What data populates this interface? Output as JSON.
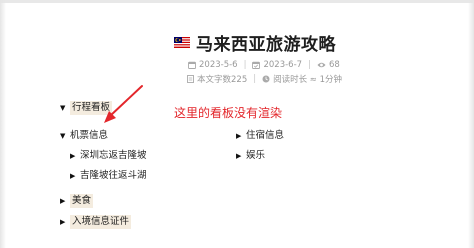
{
  "doc": {
    "title": "马来西亚旅游攻略",
    "flag_icon": "malaysia-flag-icon",
    "created": "2023-5-6",
    "updated": "2023-6-7",
    "views": "68",
    "word_count": "本文字数225",
    "read_time": "阅读时长 ≈ 1分钟"
  },
  "mindmap": {
    "root": "行程看板",
    "branches": [
      {
        "label": "机票信息",
        "children": [
          "深圳忘返吉隆坡",
          "吉隆坡往返斗湖"
        ]
      },
      {
        "label": "住宿信息"
      },
      {
        "label": "娱乐"
      },
      {
        "label": "美食"
      },
      {
        "label": "入境信息证件"
      }
    ]
  },
  "annotation": {
    "text": "这里的看板没有渲染",
    "color": "#e3262b"
  },
  "colors": {
    "highlight": "#f4ecdf",
    "meta": "#999999",
    "text": "#222222"
  }
}
